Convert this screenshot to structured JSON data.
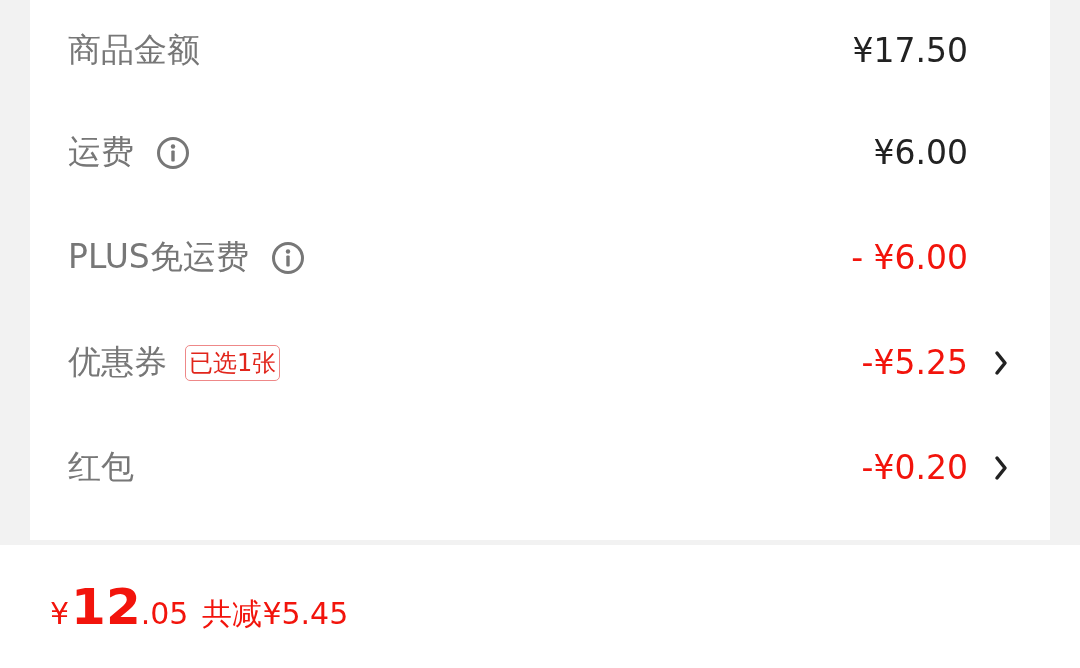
{
  "rows": [
    {
      "label": "商品金额",
      "info": false,
      "value": "¥17.50",
      "color": "#222222",
      "chevron": false
    },
    {
      "label": "运费",
      "info": true,
      "value": "¥6.00",
      "color": "#222222",
      "chevron": false
    },
    {
      "label": "PLUS免运费",
      "info": true,
      "value": "- ¥6.00",
      "color": "#f2140c",
      "chevron": false
    },
    {
      "label": "优惠券",
      "info": false,
      "badge": "已选1张",
      "value": "-¥5.25",
      "color": "#f2140c",
      "chevron": true
    },
    {
      "label": "红包",
      "info": false,
      "value": "-¥0.20",
      "color": "#f2140c",
      "chevron": true
    }
  ],
  "footer": {
    "currency": "¥",
    "integer": "12",
    "decimal": ".05",
    "saving": "共减¥5.45"
  }
}
